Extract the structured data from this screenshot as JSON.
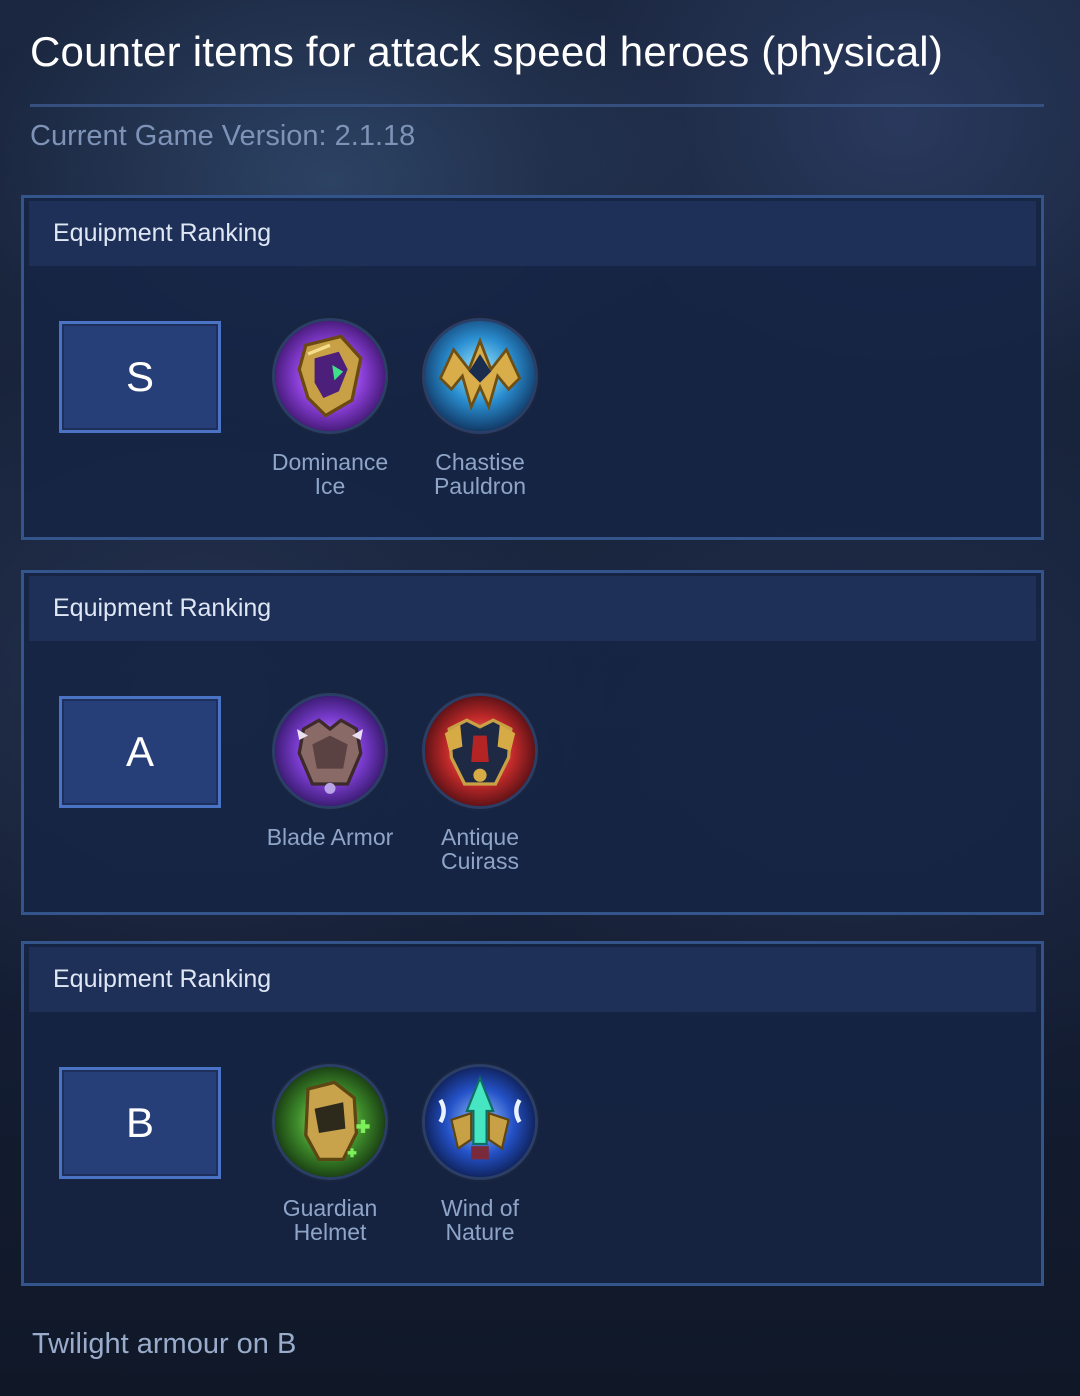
{
  "page_title": "Counter items for attack speed heroes (physical)",
  "version_text": "Current Game Version: 2.1.18",
  "tiers": [
    {
      "header": "Equipment Ranking",
      "rank": "S",
      "items": [
        {
          "name": "Dominance Ice",
          "icon": "dominance-ice-icon"
        },
        {
          "name": "Chastise Pauldron",
          "icon": "chastise-pauldron-icon"
        }
      ]
    },
    {
      "header": "Equipment Ranking",
      "rank": "A",
      "items": [
        {
          "name": "Blade Armor",
          "icon": "blade-armor-icon"
        },
        {
          "name": "Antique Cuirass",
          "icon": "antique-cuirass-icon"
        }
      ]
    },
    {
      "header": "Equipment Ranking",
      "rank": "B",
      "items": [
        {
          "name": "Guardian Helmet",
          "icon": "guardian-helmet-icon"
        },
        {
          "name": "Wind of Nature",
          "icon": "wind-of-nature-icon"
        }
      ]
    }
  ],
  "footnote": "Twilight armour on B",
  "colors": {
    "panel_border": "#34548c",
    "rank_box": "#273f78",
    "item_text": "#8fa5c8"
  }
}
